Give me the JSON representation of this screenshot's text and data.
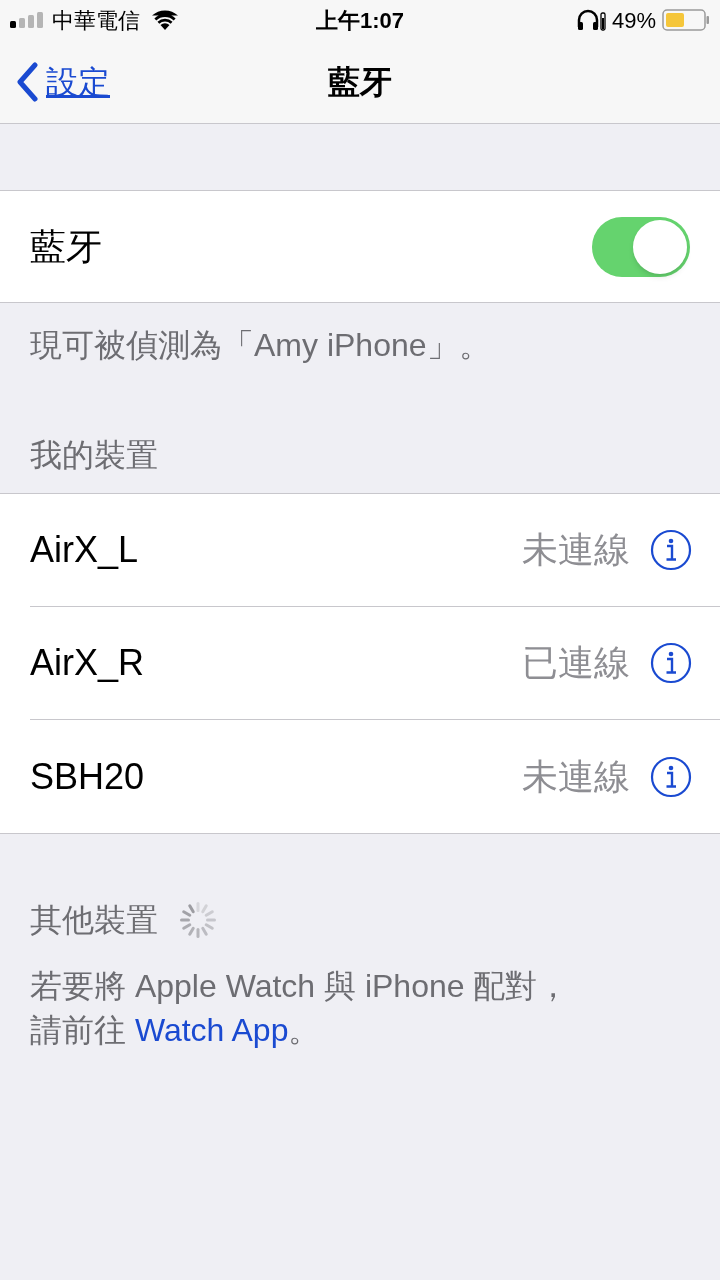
{
  "status_bar": {
    "carrier": "中華電信",
    "time": "上午1:07",
    "battery_percent": "49%"
  },
  "nav": {
    "back": "設定",
    "title": "藍牙"
  },
  "bluetooth": {
    "label": "藍牙",
    "on": true
  },
  "discoverable_note": "現可被偵測為「Amy iPhone」。",
  "my_devices": {
    "header": "我的裝置",
    "devices": [
      {
        "name": "AirX_L",
        "status": "未連線"
      },
      {
        "name": "AirX_R",
        "status": "已連線"
      },
      {
        "name": "SBH20",
        "status": "未連線"
      }
    ]
  },
  "other_devices": {
    "header": "其他裝置",
    "searching": true
  },
  "footer": {
    "text": "若要將 Apple Watch 與 iPhone 配對，請前往 ",
    "link": "Watch App",
    "text_after": "。"
  }
}
